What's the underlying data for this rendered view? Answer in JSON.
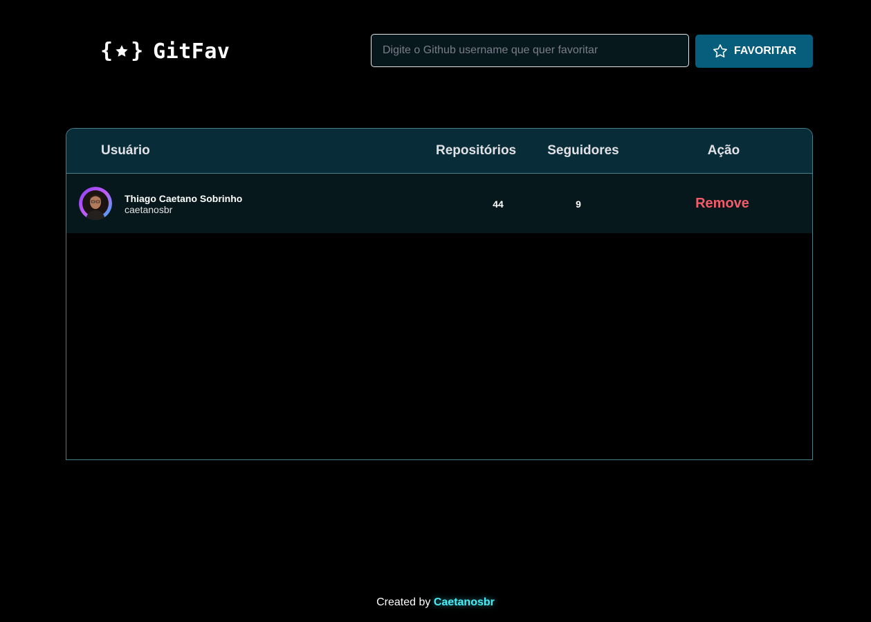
{
  "header": {
    "logo_text": "GitFav",
    "search": {
      "placeholder": "Digite o Github username que quer favoritar",
      "value": ""
    },
    "favorite_button_label": "FAVORITAR",
    "favorite_icon": "star-outline-icon"
  },
  "table": {
    "columns": [
      "Usuário",
      "Repositórios",
      "Seguidores",
      "Ação"
    ],
    "rows": [
      {
        "name": "Thiago Caetano Sobrinho",
        "login": "caetanosbr",
        "repositories": "44",
        "followers": "9",
        "action_label": "Remove"
      }
    ]
  },
  "footer": {
    "prefix": "Created by",
    "link_text": "Caetanosbr"
  },
  "colors": {
    "background": "#000000",
    "accent_button": "#065e7c",
    "table_header": "#092d38",
    "row_background": "#06181c",
    "remove": "#f75a68",
    "footer_link": "#4aecf5"
  }
}
